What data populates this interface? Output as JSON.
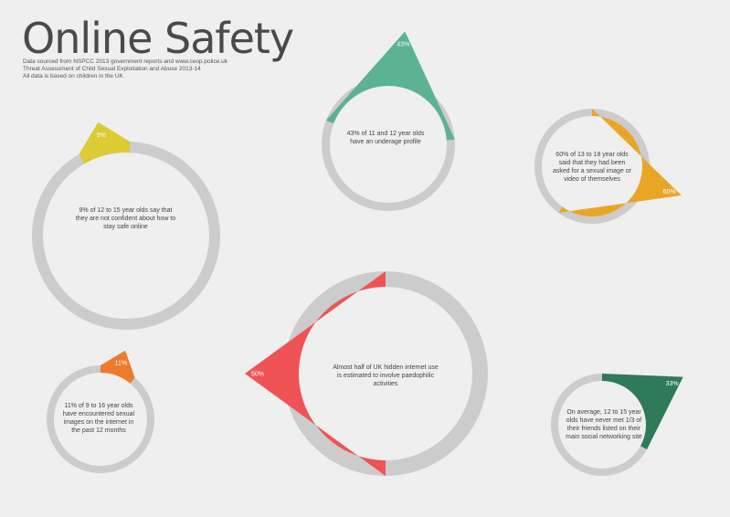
{
  "header": {
    "title": "Online Safety",
    "sources": [
      "Data sourced from NSPCC 2013 government reports and www.ceop.police.uk",
      "Threat Assessment of Child Sexual Exploitation and Abuse 2013-14",
      "All data is based on children in the UK"
    ]
  },
  "chart_data": {
    "type": "pie",
    "track_color": "#cccccc",
    "items": [
      {
        "value": 9,
        "label": "9%",
        "text": "9% of 12 to 15 year olds say that they are not confident about how to stay safe online",
        "color": "#dccb33"
      },
      {
        "value": 43,
        "label": "43%",
        "text": "43% of 11 and 12 year olds have an underage profile",
        "color": "#5bb393"
      },
      {
        "value": 60,
        "label": "60%",
        "text": "60% of 13 to 18 year olds said that they had been asked for a sexual image or video of themselves",
        "color": "#e9a626"
      },
      {
        "value": 11,
        "label": "11%",
        "text": "11% of 9 to 16 year olds have encountered sexual images on the internet in the past 12 months",
        "color": "#ee7a2b"
      },
      {
        "value": 50,
        "label": "50%",
        "text": "Almost half of UK hidden internet use is estimated to involve paedophilic activities",
        "color": "#ef5355"
      },
      {
        "value": 33,
        "label": "33%",
        "text": "On average, 12 to 15 year olds have never met 1/3 of their friends listed on their main social networking site",
        "color": "#2f7a58"
      }
    ]
  }
}
